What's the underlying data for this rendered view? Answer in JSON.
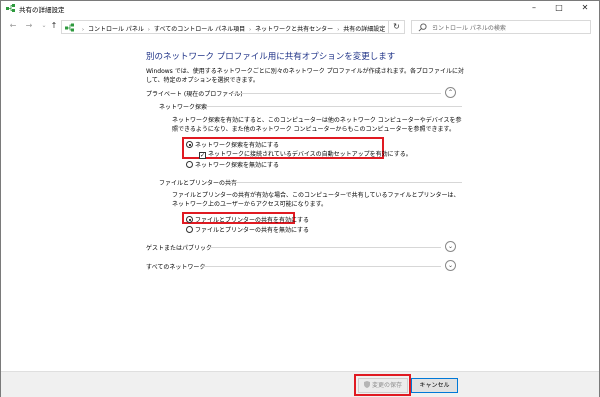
{
  "window": {
    "title": "共有の詳細設定",
    "minimize_glyph": "–",
    "maximize_glyph": "□",
    "close_glyph": "✕"
  },
  "addressbar": {
    "back_glyph": "←",
    "forward_glyph": "→",
    "recent_glyph": "⌄",
    "up_glyph": "↑",
    "breadcrumbs": [
      "コントロール パネル",
      "すべてのコントロール パネル項目",
      "ネットワークと共有センター",
      "共有の詳細設定"
    ],
    "separator_glyph": "›",
    "dropdown_glyph": "⌄",
    "refresh_glyph": "↻",
    "search_placeholder": "コントロール パネルの検索"
  },
  "page": {
    "title": "別のネットワーク プロファイル用に共有オプションを変更します",
    "intro": "Windows では、使用するネットワークごとに別々のネットワーク プロファイルが作成されます。各プロファイルに対して、特定のオプションを選択できます。"
  },
  "private_section": {
    "label": "プライベート (現在のプロファイル)",
    "toggle_glyph": "⌃",
    "discovery": {
      "heading": "ネットワーク探索",
      "description": "ネットワーク探索を有効にすると、このコンピューターは他のネットワーク コンピューターやデバイスを参照できるようになり、また他のネットワーク コンピューターからもこのコンピューターを参照できます。",
      "option_on": "ネットワーク探索を有効にする",
      "auto_setup": "ネットワークに接続されているデバイスの自動セットアップを有効にする。",
      "option_off": "ネットワーク探索を無効にする",
      "selected": "on",
      "auto_setup_checked": true
    },
    "file_sharing": {
      "heading": "ファイルとプリンターの共有",
      "description": "ファイルとプリンターの共有が有効な場合、このコンピューターで共有しているファイルとプリンターは、ネットワーク上のユーザーからアクセス可能になります。",
      "option_on": "ファイルとプリンターの共有を有効にする",
      "option_off": "ファイルとプリンターの共有を無効にする",
      "selected": "on"
    }
  },
  "guest_section": {
    "label": "ゲストまたはパブリック",
    "toggle_glyph": "⌄"
  },
  "all_section": {
    "label": "すべてのネットワーク",
    "toggle_glyph": "⌄"
  },
  "footer": {
    "save_label": "変更の保存",
    "cancel_label": "キャンセル"
  },
  "colors": {
    "title_blue": "#1e3287",
    "highlight_red": "#e01a22",
    "shield_blue": "#2a6cc7",
    "shield_yellow": "#f2c200",
    "network_green": "#2e9a3e"
  }
}
